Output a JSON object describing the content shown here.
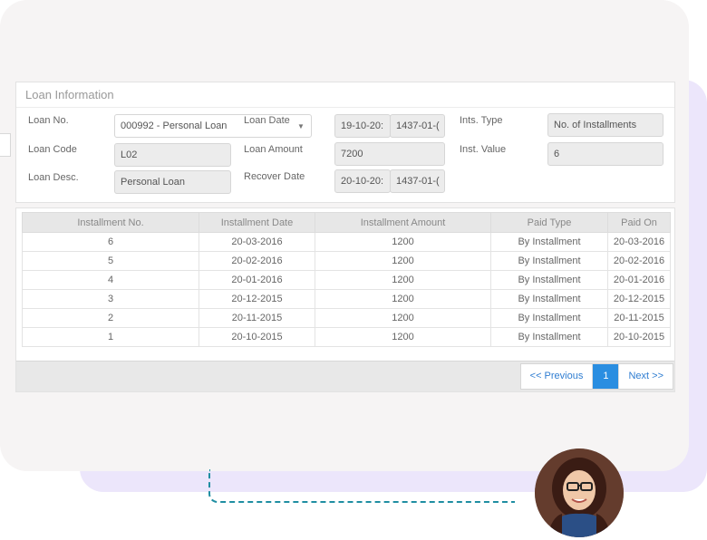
{
  "panel": {
    "title": "Loan Information",
    "labels": {
      "loan_no": "Loan No.",
      "loan_code": "Loan Code",
      "loan_desc": "Loan Desc.",
      "loan_date": "Loan Date",
      "loan_amount": "Loan Amount",
      "recover_date": "Recover Date",
      "ints_type": "Ints. Type",
      "inst_value": "Inst. Value"
    },
    "values": {
      "loan_no": "000992 - Personal Loan",
      "loan_code": "L02",
      "loan_desc": "Personal Loan",
      "loan_date_greg": "19-10-20:",
      "loan_date_hijri": "1437-01-(",
      "loan_amount": "7200",
      "recover_date_greg": "20-10-20:",
      "recover_date_hijri": "1437-01-(",
      "ints_type": "No. of Installments",
      "inst_value": "6"
    },
    "caret": "▼"
  },
  "table": {
    "headers": [
      "Installment No.",
      "Installment Date",
      "Installment Amount",
      "Paid Type",
      "Paid On"
    ],
    "rows": [
      [
        "6",
        "20-03-2016",
        "1200",
        "By Installment",
        "20-03-2016"
      ],
      [
        "5",
        "20-02-2016",
        "1200",
        "By Installment",
        "20-02-2016"
      ],
      [
        "4",
        "20-01-2016",
        "1200",
        "By Installment",
        "20-01-2016"
      ],
      [
        "3",
        "20-12-2015",
        "1200",
        "By Installment",
        "20-12-2015"
      ],
      [
        "2",
        "20-11-2015",
        "1200",
        "By Installment",
        "20-11-2015"
      ],
      [
        "1",
        "20-10-2015",
        "1200",
        "By Installment",
        "20-10-2015"
      ]
    ]
  },
  "pager": {
    "previous": "<< Previous",
    "current": "1",
    "next": "Next >>"
  },
  "colors": {
    "accent": "#2a8ee1",
    "connector": "#1f8ea2",
    "purple_bg": "#ece6fb"
  },
  "icons": {
    "dropdown": "chevron-down-icon",
    "avatar": "user-photo"
  }
}
